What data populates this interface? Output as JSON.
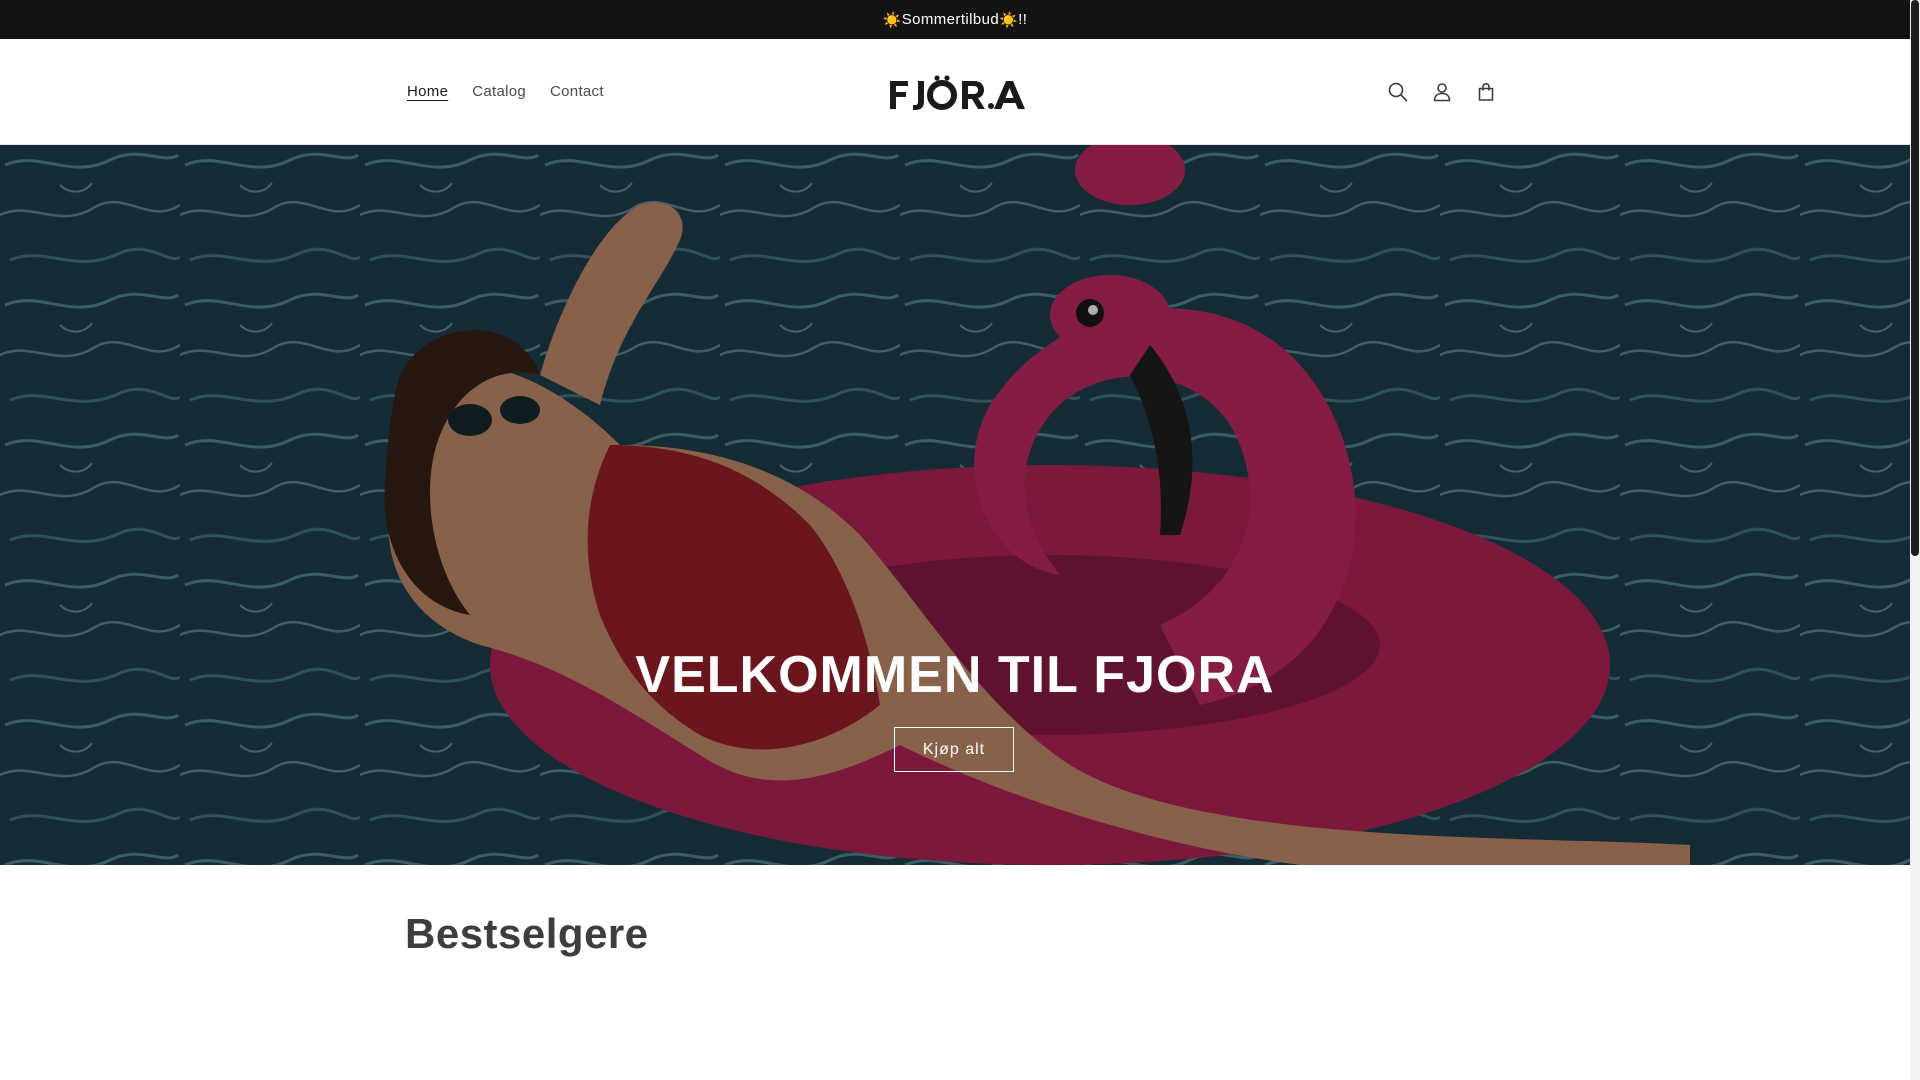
{
  "announcement": {
    "text_sun": "☀️",
    "text": "Sommertilbud",
    "text_end": "!!"
  },
  "header": {
    "nav": [
      {
        "label": "Home",
        "active": true
      },
      {
        "label": "Catalog",
        "active": false
      },
      {
        "label": "Contact",
        "active": false
      }
    ],
    "logo_text": "FJORA",
    "icons": [
      "search-icon",
      "account-icon",
      "cart-icon"
    ]
  },
  "hero": {
    "title": "VELKOMMEN TIL FJORA",
    "button_label": "Kjøp alt"
  },
  "bestsellers": {
    "title": "Bestselgere"
  },
  "colors": {
    "announcement_bg": "#131313",
    "text_dark": "#1a1a1a",
    "pool_blue": "#1e3c48",
    "flamingo_pink": "#b8245a",
    "swimsuit_red": "#9e1f2a"
  }
}
